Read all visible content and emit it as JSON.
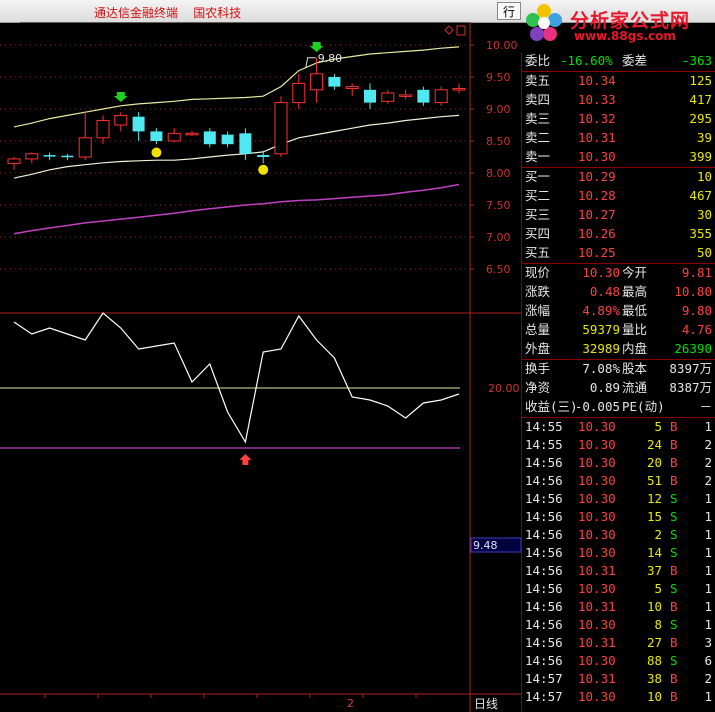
{
  "titlebar": {
    "title": "通达信金融终端    国农科技",
    "button": "行"
  },
  "logo": {
    "text": "分析家公式网",
    "url": "www.88gs.com"
  },
  "colors": {
    "up": "#ff3030",
    "down": "#50e8f0",
    "axis": "#b02020",
    "mid_band": "#e8e8c8",
    "purple": "#c040c0"
  },
  "chart": {
    "price_ticks": [
      "10.00",
      "9.50",
      "9.00",
      "8.50",
      "8.00",
      "7.50",
      "7.00",
      "6.50"
    ],
    "price_range": [
      6.5,
      10.0
    ],
    "high_label": "9.80",
    "indicator_tick": "20.00",
    "cursor_value": "9.48",
    "period_label": "日线",
    "bottom_mark": "2",
    "candles": [
      {
        "o": 8.15,
        "h": 8.25,
        "l": 8.05,
        "c": 8.22
      },
      {
        "o": 8.22,
        "h": 8.32,
        "l": 8.15,
        "c": 8.3
      },
      {
        "o": 8.28,
        "h": 8.32,
        "l": 8.2,
        "c": 8.27
      },
      {
        "o": 8.27,
        "h": 8.3,
        "l": 8.2,
        "c": 8.25
      },
      {
        "o": 8.25,
        "h": 8.95,
        "l": 8.2,
        "c": 8.55
      },
      {
        "o": 8.55,
        "h": 8.9,
        "l": 8.45,
        "c": 8.82
      },
      {
        "o": 8.75,
        "h": 8.95,
        "l": 8.65,
        "c": 8.9
      },
      {
        "o": 8.88,
        "h": 8.95,
        "l": 8.5,
        "c": 8.65
      },
      {
        "o": 8.65,
        "h": 8.7,
        "l": 8.45,
        "c": 8.5
      },
      {
        "o": 8.5,
        "h": 8.7,
        "l": 8.48,
        "c": 8.62
      },
      {
        "o": 8.62,
        "h": 8.66,
        "l": 8.58,
        "c": 8.62
      },
      {
        "o": 8.65,
        "h": 8.7,
        "l": 8.4,
        "c": 8.45
      },
      {
        "o": 8.6,
        "h": 8.65,
        "l": 8.4,
        "c": 8.45
      },
      {
        "o": 8.62,
        "h": 8.7,
        "l": 8.2,
        "c": 8.3
      },
      {
        "o": 8.28,
        "h": 8.35,
        "l": 8.15,
        "c": 8.25
      },
      {
        "o": 8.3,
        "h": 9.2,
        "l": 8.25,
        "c": 9.1
      },
      {
        "o": 9.1,
        "h": 9.55,
        "l": 9.0,
        "c": 9.4
      },
      {
        "o": 9.3,
        "h": 9.8,
        "l": 9.1,
        "c": 9.55
      },
      {
        "o": 9.5,
        "h": 9.55,
        "l": 9.3,
        "c": 9.35
      },
      {
        "o": 9.32,
        "h": 9.4,
        "l": 9.2,
        "c": 9.35
      },
      {
        "o": 9.3,
        "h": 9.4,
        "l": 9.0,
        "c": 9.1
      },
      {
        "o": 9.12,
        "h": 9.3,
        "l": 9.08,
        "c": 9.25
      },
      {
        "o": 9.2,
        "h": 9.3,
        "l": 9.15,
        "c": 9.22
      },
      {
        "o": 9.3,
        "h": 9.35,
        "l": 9.05,
        "c": 9.1
      },
      {
        "o": 9.1,
        "h": 9.35,
        "l": 9.05,
        "c": 9.3
      },
      {
        "o": 9.3,
        "h": 9.4,
        "l": 9.25,
        "c": 9.32
      }
    ],
    "upper_band": [
      8.72,
      8.78,
      8.85,
      8.9,
      8.95,
      9.0,
      9.05,
      9.08,
      9.1,
      9.12,
      9.15,
      9.16,
      9.17,
      9.18,
      9.2,
      9.35,
      9.6,
      9.72,
      9.78,
      9.82,
      9.86,
      9.88,
      9.9,
      9.92,
      9.95,
      9.97
    ],
    "lower_band": [
      7.92,
      7.98,
      8.05,
      8.1,
      8.13,
      8.16,
      8.18,
      8.19,
      8.2,
      8.2,
      8.22,
      8.25,
      8.28,
      8.3,
      8.33,
      8.45,
      8.55,
      8.6,
      8.65,
      8.7,
      8.75,
      8.78,
      8.82,
      8.85,
      8.88,
      8.9
    ],
    "ma_long": [
      7.05,
      7.1,
      7.14,
      7.18,
      7.22,
      7.25,
      7.28,
      7.31,
      7.34,
      7.37,
      7.41,
      7.44,
      7.47,
      7.5,
      7.52,
      7.55,
      7.57,
      7.58,
      7.6,
      7.62,
      7.64,
      7.66,
      7.7,
      7.73,
      7.77,
      7.82
    ],
    "indicator": [
      42,
      38,
      40,
      38,
      36,
      45,
      40,
      33,
      34,
      35,
      22,
      28,
      12,
      2,
      32,
      33,
      44,
      36,
      30,
      17,
      16,
      14,
      10,
      15,
      16,
      18
    ],
    "indicator_range": [
      0,
      50
    ],
    "yellow_line": 20,
    "purple_line": 0
  },
  "panel": {
    "weibi": {
      "label": "委比",
      "value": "-16.60%",
      "label2": "委差",
      "value2": "-363"
    },
    "sells": [
      {
        "label": "卖五",
        "price": "10.34",
        "vol": "125"
      },
      {
        "label": "卖四",
        "price": "10.33",
        "vol": "417"
      },
      {
        "label": "卖三",
        "price": "10.32",
        "vol": "295"
      },
      {
        "label": "卖二",
        "price": "10.31",
        "vol": "39"
      },
      {
        "label": "卖一",
        "price": "10.30",
        "vol": "399"
      }
    ],
    "buys": [
      {
        "label": "买一",
        "price": "10.29",
        "vol": "10"
      },
      {
        "label": "买二",
        "price": "10.28",
        "vol": "467"
      },
      {
        "label": "买三",
        "price": "10.27",
        "vol": "30"
      },
      {
        "label": "买四",
        "price": "10.26",
        "vol": "355"
      },
      {
        "label": "买五",
        "price": "10.25",
        "vol": "50"
      }
    ],
    "quote": [
      {
        "l1": "现价",
        "v1": "10.30",
        "l2": "今开",
        "v2": "9.81"
      },
      {
        "l1": "涨跌",
        "v1": "0.48",
        "l2": "最高",
        "v2": "10.80"
      },
      {
        "l1": "涨幅",
        "v1": "4.89%",
        "l2": "最低",
        "v2": "9.80"
      },
      {
        "l1": "总量",
        "v1": "59379",
        "l2": "量比",
        "v2": "4.76"
      },
      {
        "l1": "外盘",
        "v1": "32989",
        "l2": "内盘",
        "v2": "26390"
      }
    ],
    "fundamentals": [
      {
        "l1": "换手",
        "v1": "7.08%",
        "l2": "股本",
        "v2": "8397万"
      },
      {
        "l1": "净资",
        "v1": "0.89",
        "l2": "流通",
        "v2": "8387万"
      },
      {
        "l1": "收益(三)",
        "v1": "-0.005",
        "l2": "PE(动)",
        "v2": "－"
      }
    ],
    "ticks": [
      {
        "t": "14:55",
        "p": "10.30",
        "v": "5",
        "s": "B",
        "n": "1"
      },
      {
        "t": "14:55",
        "p": "10.30",
        "v": "24",
        "s": "B",
        "n": "2"
      },
      {
        "t": "14:56",
        "p": "10.30",
        "v": "20",
        "s": "B",
        "n": "2"
      },
      {
        "t": "14:56",
        "p": "10.30",
        "v": "51",
        "s": "B",
        "n": "2"
      },
      {
        "t": "14:56",
        "p": "10.30",
        "v": "12",
        "s": "S",
        "n": "1"
      },
      {
        "t": "14:56",
        "p": "10.30",
        "v": "15",
        "s": "S",
        "n": "1"
      },
      {
        "t": "14:56",
        "p": "10.30",
        "v": "2",
        "s": "S",
        "n": "1"
      },
      {
        "t": "14:56",
        "p": "10.30",
        "v": "14",
        "s": "S",
        "n": "1"
      },
      {
        "t": "14:56",
        "p": "10.31",
        "v": "37",
        "s": "B",
        "n": "1"
      },
      {
        "t": "14:56",
        "p": "10.30",
        "v": "5",
        "s": "S",
        "n": "1"
      },
      {
        "t": "14:56",
        "p": "10.31",
        "v": "10",
        "s": "B",
        "n": "1"
      },
      {
        "t": "14:56",
        "p": "10.30",
        "v": "8",
        "s": "S",
        "n": "1"
      },
      {
        "t": "14:56",
        "p": "10.31",
        "v": "27",
        "s": "B",
        "n": "3"
      },
      {
        "t": "14:56",
        "p": "10.30",
        "v": "88",
        "s": "S",
        "n": "6"
      },
      {
        "t": "14:57",
        "p": "10.31",
        "v": "38",
        "s": "B",
        "n": "2"
      },
      {
        "t": "14:57",
        "p": "10.30",
        "v": "10",
        "s": "B",
        "n": "1"
      }
    ]
  }
}
